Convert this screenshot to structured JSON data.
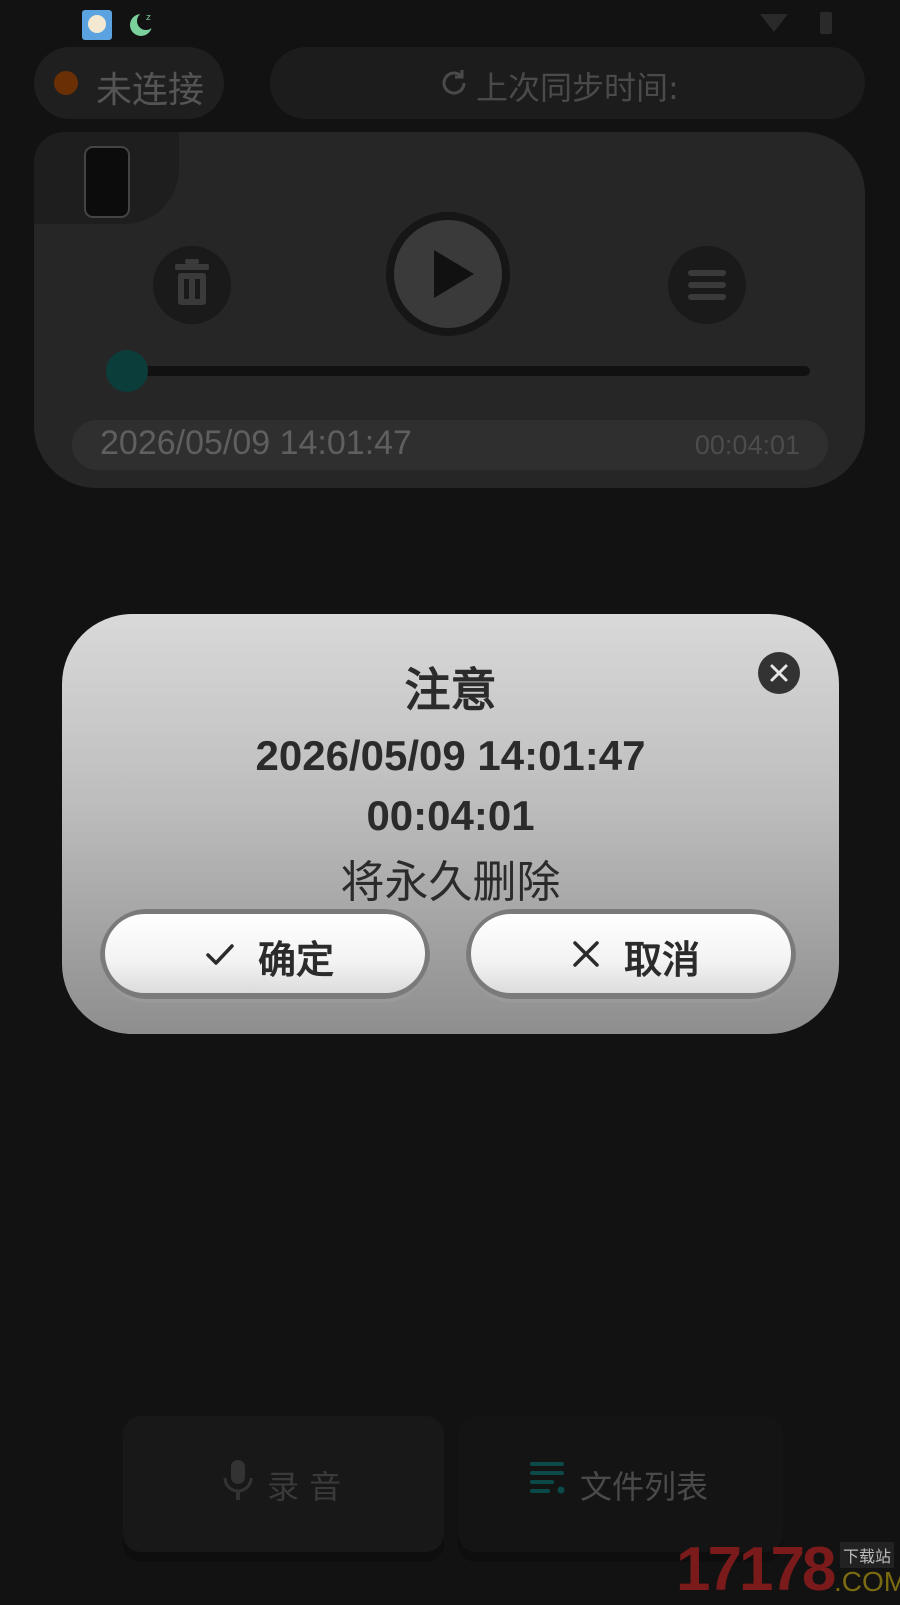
{
  "status_bar": {
    "icons": [
      "app-avatar-icon",
      "moon-sleep-icon",
      "wifi-icon",
      "battery-icon"
    ]
  },
  "header": {
    "connection_status": "未连接",
    "sync_label": "上次同步时间:"
  },
  "player": {
    "recording_datetime": "2026/05/09 14:01:47",
    "duration": "00:04:01",
    "progress": 0.0
  },
  "dialog": {
    "title": "注意",
    "datetime": "2026/05/09 14:01:47",
    "duration": "00:04:01",
    "message": "将永久删除",
    "confirm_label": "确定",
    "cancel_label": "取消"
  },
  "nav": {
    "record_label": "录 音",
    "files_label": "文件列表"
  },
  "watermark": {
    "number": "17178",
    "suffix": ".COM",
    "tag": "下载站"
  },
  "colors": {
    "dialog_top": "#d9d9d9",
    "dialog_bottom": "#8e8e8e",
    "accent_teal": "#0b3d3a",
    "status_dot": "#6b2f05"
  }
}
